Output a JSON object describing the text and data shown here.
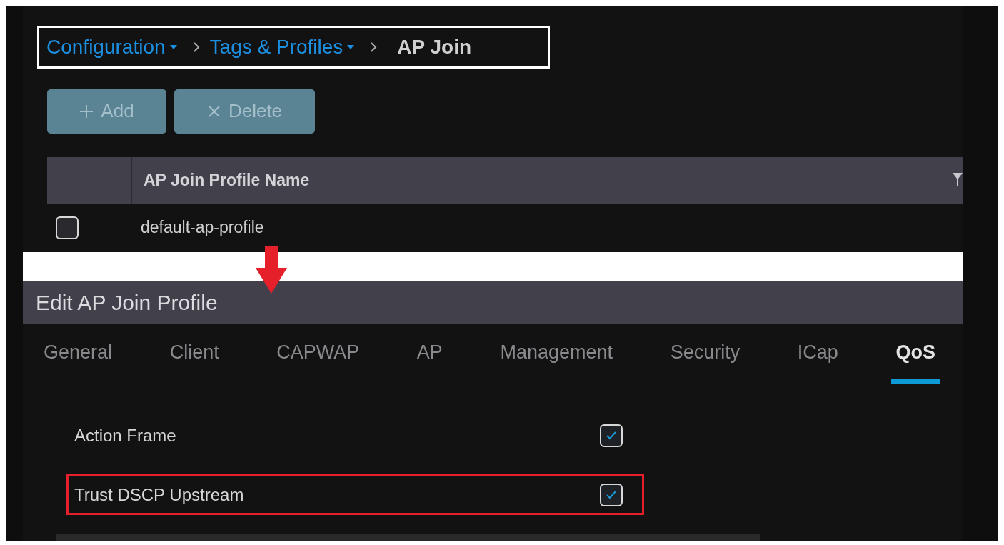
{
  "breadcrumb": [
    {
      "label": "Configuration",
      "kind": "link"
    },
    {
      "label": "Tags & Profiles",
      "kind": "link"
    },
    {
      "label": "AP Join",
      "kind": "current"
    }
  ],
  "buttons": [
    {
      "label": "Add",
      "kind": "add",
      "disabled": true
    },
    {
      "label": "Delete",
      "kind": "delete",
      "disabled": true
    }
  ],
  "table": {
    "columns": [
      "AP Join Profile Name"
    ],
    "rows": [
      {
        "name": "default-ap-profile",
        "checked": false
      }
    ]
  },
  "edit_panel": {
    "title": "Edit AP Join Profile",
    "tabs": [
      {
        "label": "General",
        "selected": false
      },
      {
        "label": "Client",
        "selected": false
      },
      {
        "label": "CAPWAP",
        "selected": false
      },
      {
        "label": "AP",
        "selected": false
      },
      {
        "label": "Management",
        "selected": false
      },
      {
        "label": "Security",
        "selected": false
      },
      {
        "label": "ICap",
        "selected": false
      },
      {
        "label": "QoS",
        "selected": true
      }
    ],
    "settings": [
      {
        "label": "Action Frame",
        "checked": true,
        "highlighted": false
      },
      {
        "label": "Trust DSCP Upstream",
        "checked": true,
        "highlighted": true
      }
    ]
  }
}
